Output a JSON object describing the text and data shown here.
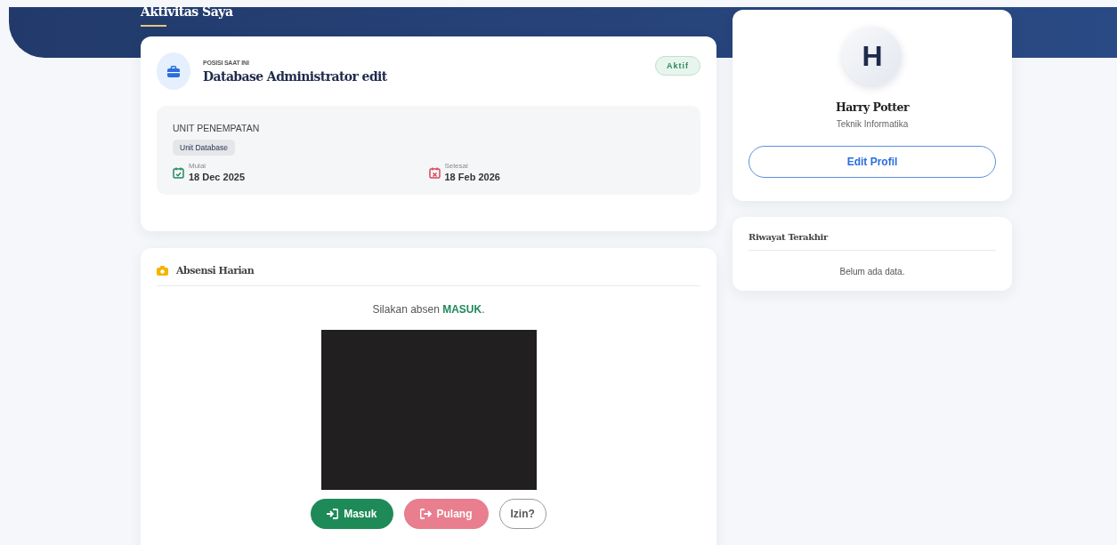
{
  "page": {
    "title": "Aktivitas Saya"
  },
  "position_card": {
    "label": "POSISI SAAT INI",
    "title": "Database Administrator edit",
    "status": "Aktif",
    "unit_label": "UNIT PENEMPATAN",
    "unit": "Unit Database",
    "dates": [
      {
        "kind": "start",
        "label": "Mulai",
        "date": "18 Dec 2025"
      },
      {
        "kind": "end",
        "label": "Selesai",
        "date": "18 Feb 2026"
      }
    ]
  },
  "attendance": {
    "title": "Absensi Harian",
    "prompt": "Silakan absen **MASUK**.",
    "buttons": [
      {
        "kind": "checkin",
        "label": "Masuk",
        "disabled": false
      },
      {
        "kind": "checkout",
        "label": "Pulang",
        "disabled": true
      },
      {
        "kind": "leave",
        "label": "Izin?",
        "disabled": false
      }
    ]
  },
  "profile": {
    "initial": "H",
    "name": "Harry Potter",
    "department": "Teknik Informatika",
    "button": "Edit Profil"
  },
  "history": {
    "title": "Riwayat Terakhir",
    "empty": "Belum ada data."
  }
}
